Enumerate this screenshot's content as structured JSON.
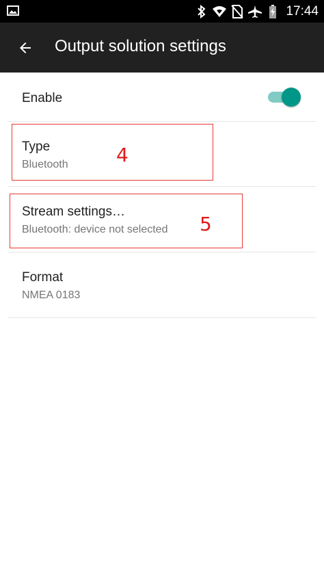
{
  "status_bar": {
    "time": "17:44",
    "icons": [
      "image-icon",
      "bluetooth-icon",
      "wifi-icon",
      "no-sim-icon",
      "airplane-icon",
      "battery-icon"
    ]
  },
  "app_bar": {
    "title": "Output solution settings",
    "back_icon": "arrow-back-icon"
  },
  "settings": {
    "enable": {
      "title": "Enable",
      "checked": true
    },
    "type": {
      "title": "Type",
      "summary": "Bluetooth"
    },
    "stream": {
      "title": "Stream settings…",
      "summary": "Bluetooth: device not selected"
    },
    "format": {
      "title": "Format",
      "summary": "NMEA 0183"
    }
  },
  "annotations": {
    "type_marker": "4",
    "stream_marker": "5"
  },
  "colors": {
    "accent": "#009688",
    "accent_track": "#80cbc4",
    "annotation": "#e53935",
    "app_bar": "#212121"
  }
}
